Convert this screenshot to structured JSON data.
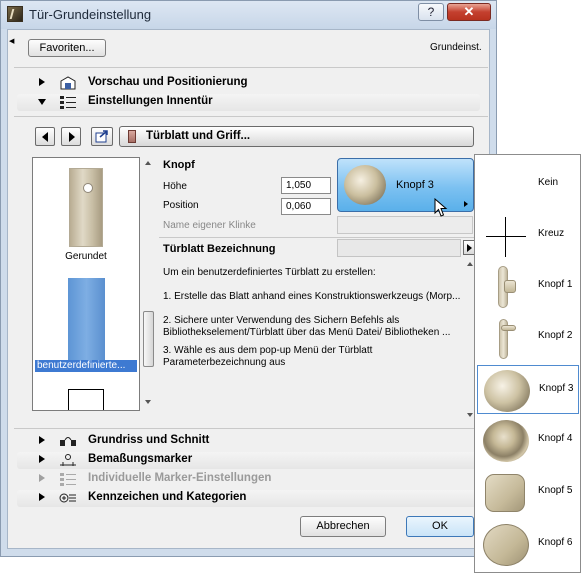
{
  "window": {
    "title": "Tür-Grundeinstellung",
    "help_label": "?",
    "close_label": "✕"
  },
  "toolbar": {
    "favorites_label": "Favoriten...",
    "preset_label": "Grundeinst."
  },
  "panels": {
    "preview_label": "Vorschau und Positionierung",
    "inner_door_label": "Einstellungen Innentür",
    "plan_section_label": "Grundriss und Schnitt",
    "dimension_label": "Bemaßungsmarker",
    "custom_marker_label": "Individuelle Marker-Einstellungen",
    "listing_label": "Kennzeichen und Kategorien"
  },
  "subpage": {
    "label": "Türblatt und Griff..."
  },
  "preview_list": {
    "items": [
      {
        "label": "Gerundet"
      },
      {
        "label": "benutzerdefinierte..."
      }
    ]
  },
  "knob": {
    "section_label": "Knopf",
    "height_label": "Höhe",
    "height_value": "1,050",
    "position_label": "Position",
    "position_value": "0,060",
    "custom_handle_label": "Name eigener Klinke",
    "selected_label": "Knopf 3"
  },
  "leaf": {
    "label": "Türblatt Bezeichnung",
    "info_title": "Um ein benutzerdefiniertes Türblatt zu erstellen:",
    "step1": "1. Erstelle das Blatt anhand eines Konstruktionswerkzeugs (Morp...",
    "step2a": "2. Sichere unter Verwendung des Sichern Befehls als",
    "step2b": "Bibliothekselement/Türblatt über das Menü Datei/ Bibliotheken ...",
    "step3a": "3. Wähle es aus dem pop-up Menü der Türblatt",
    "step3b": "Parameterbezeichnung aus"
  },
  "buttons": {
    "cancel": "Abbrechen",
    "ok": "OK"
  },
  "popup": {
    "items": [
      {
        "label": "Kein",
        "icon": "empty"
      },
      {
        "label": "Kreuz",
        "icon": "cross-icon"
      },
      {
        "label": "Knopf 1",
        "icon": "handle-1-icon"
      },
      {
        "label": "Knopf 2",
        "icon": "handle-2-icon"
      },
      {
        "label": "Knopf 3",
        "icon": "knob-3-icon",
        "selected": true
      },
      {
        "label": "Knopf 4",
        "icon": "knob-4-icon"
      },
      {
        "label": "Knopf 5",
        "icon": "knob-5-icon"
      },
      {
        "label": "Knopf 6",
        "icon": "knob-6-icon"
      }
    ]
  },
  "colors": {
    "selection": "#3e7ad2",
    "title_bar": "#cfdceb",
    "close_button": "#c4402f"
  }
}
